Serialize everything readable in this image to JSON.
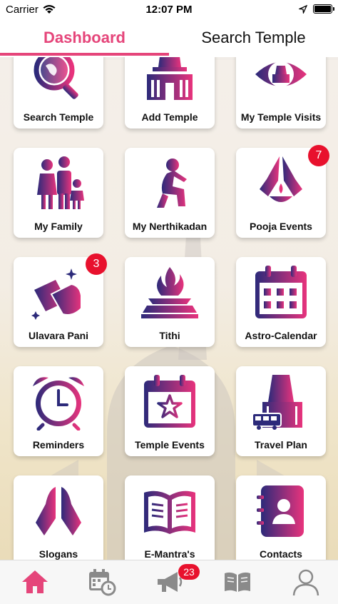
{
  "status_bar": {
    "carrier": "Carrier",
    "time": "12:07 PM"
  },
  "tabs": [
    {
      "label": "Dashboard",
      "active": true
    },
    {
      "label": "Search Temple",
      "active": false
    }
  ],
  "colors": {
    "accent": "#e5457a",
    "gradient_start": "#2c2a7a",
    "gradient_end": "#e8337c",
    "badge": "#e8112d"
  },
  "tiles": [
    {
      "label": "Search Temple",
      "icon": "globe-magnifier-icon"
    },
    {
      "label": "Add Temple",
      "icon": "temple-icon"
    },
    {
      "label": "My Temple Visits",
      "icon": "eye-temple-icon"
    },
    {
      "label": "My Family",
      "icon": "family-icon"
    },
    {
      "label": "My Nerthikadan",
      "icon": "kneeling-person-icon"
    },
    {
      "label": "Pooja Events",
      "icon": "praying-hands-lamp-icon",
      "badge": "7"
    },
    {
      "label": "Ulavara Pani",
      "icon": "cleaning-hand-icon",
      "badge": "3"
    },
    {
      "label": "Tithi",
      "icon": "fire-altar-icon"
    },
    {
      "label": "Astro-Calendar",
      "icon": "calendar-icon"
    },
    {
      "label": "Reminders",
      "icon": "alarm-clock-icon"
    },
    {
      "label": "Temple Events",
      "icon": "calendar-star-icon"
    },
    {
      "label": "Travel Plan",
      "icon": "temple-bus-icon"
    },
    {
      "label": "Slogans",
      "icon": "namaste-hands-icon"
    },
    {
      "label": "E-Mantra's",
      "icon": "open-book-icon"
    },
    {
      "label": "Contacts",
      "icon": "contact-book-icon"
    }
  ],
  "bottom_nav": {
    "items": [
      {
        "icon": "home-icon",
        "active": true
      },
      {
        "icon": "calendar-clock-icon",
        "active": false
      },
      {
        "icon": "megaphone-icon",
        "active": false
      },
      {
        "icon": "book-icon",
        "active": false
      },
      {
        "icon": "user-icon",
        "active": false
      }
    ],
    "notifications_badge": "23"
  }
}
